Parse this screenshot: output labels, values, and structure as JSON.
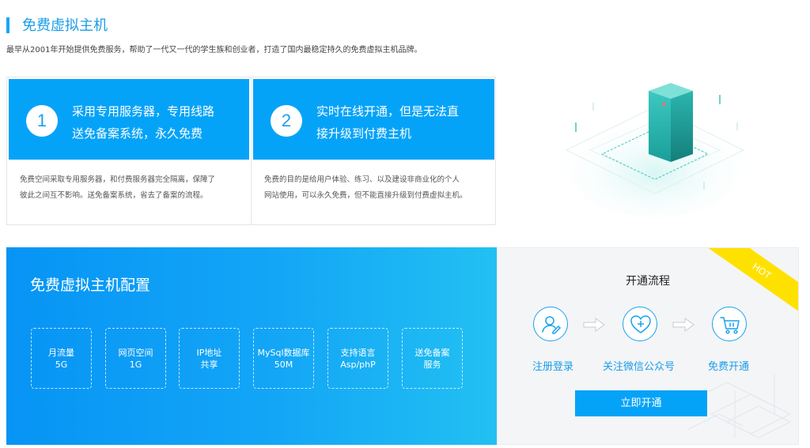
{
  "header": {
    "title": "免费虚拟主机",
    "description": "最早从2001年开始提供免费服务，帮助了一代又一代的学生族和创业者，打造了国内最稳定持久的免费虚拟主机品牌。"
  },
  "cards": [
    {
      "number": "1",
      "title_line1": "采用专用服务器，专用线路",
      "title_line2": "送免备案系统，永久免费",
      "body_line1": "免费空间采取专用服务器，和付费服务器完全隔离，保障了",
      "body_line2": "彼此之间互不影响。送免备案系统，省去了备案的流程。"
    },
    {
      "number": "2",
      "title_line1": "实时在线开通，但是无法直",
      "title_line2": "接升级到付费主机",
      "body_line1": "免费的目的是给用户体验、练习、以及建设非商业化的个人",
      "body_line2": "网站使用，可以永久免费，但不能直接升级到付费虚拟主机。"
    }
  ],
  "config": {
    "title": "免费虚拟主机配置",
    "features": [
      {
        "line1": "月流量",
        "line2": "5G"
      },
      {
        "line1": "网页空间",
        "line2": "1G"
      },
      {
        "line1": "IP地址",
        "line2": "共享"
      },
      {
        "line1": "MySql数据库",
        "line2": "50M"
      },
      {
        "line1": "支持语言",
        "line2": "Asp/phP"
      },
      {
        "line1": "送免备案",
        "line2": "服务"
      }
    ]
  },
  "process": {
    "badge": "HOT",
    "title": "开通流程",
    "steps": [
      {
        "label": "注册登录",
        "icon": "user-edit-icon"
      },
      {
        "label": "关注微信公众号",
        "icon": "heart-plus-icon"
      },
      {
        "label": "免费开通",
        "icon": "cart-icon"
      }
    ],
    "button_label": "立即开通"
  },
  "colors": {
    "accent": "#05a3f8",
    "title_blue": "#1a9de8",
    "hot_yellow": "#ffe100"
  }
}
